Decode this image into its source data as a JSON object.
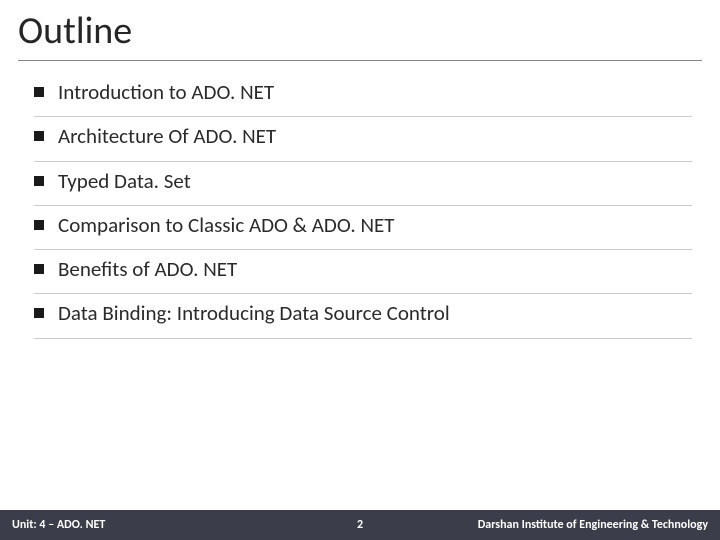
{
  "title": "Outline",
  "items": [
    "Introduction to ADO. NET",
    "Architecture Of ADO. NET",
    "Typed Data. Set",
    "Comparison to Classic ADO & ADO. NET",
    "Benefits of ADO. NET",
    "Data Binding: Introducing Data Source Control"
  ],
  "footer": {
    "left": "Unit: 4 – ADO. NET",
    "page": "2",
    "right": "Darshan Institute of Engineering & Technology"
  }
}
